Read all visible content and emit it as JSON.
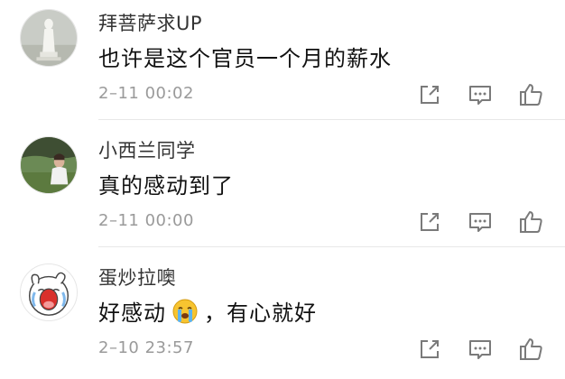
{
  "comments": [
    {
      "username": "拜菩萨求UP",
      "text": "也许是这个官员一个月的薪水",
      "time": "2–11 00:02",
      "avatar_icon": "statue-avatar"
    },
    {
      "username": "小西兰同学",
      "text": "真的感动到了",
      "time": "2–11 00:00",
      "avatar_icon": "photo-avatar"
    },
    {
      "username": "蛋炒拉噢",
      "text_before": "好感动",
      "emoji": "crying-face-emoji",
      "text_after": "，有心就好",
      "time": "2–10 23:57",
      "avatar_icon": "cartoon-crying-avatar"
    }
  ],
  "colors": {
    "text": "#111111",
    "username": "#333333",
    "timestamp": "#9a9a9a",
    "icon": "#7a7a7a",
    "divider": "#e8e8e8"
  },
  "icons": [
    "share-icon",
    "reply-icon",
    "like-icon"
  ]
}
